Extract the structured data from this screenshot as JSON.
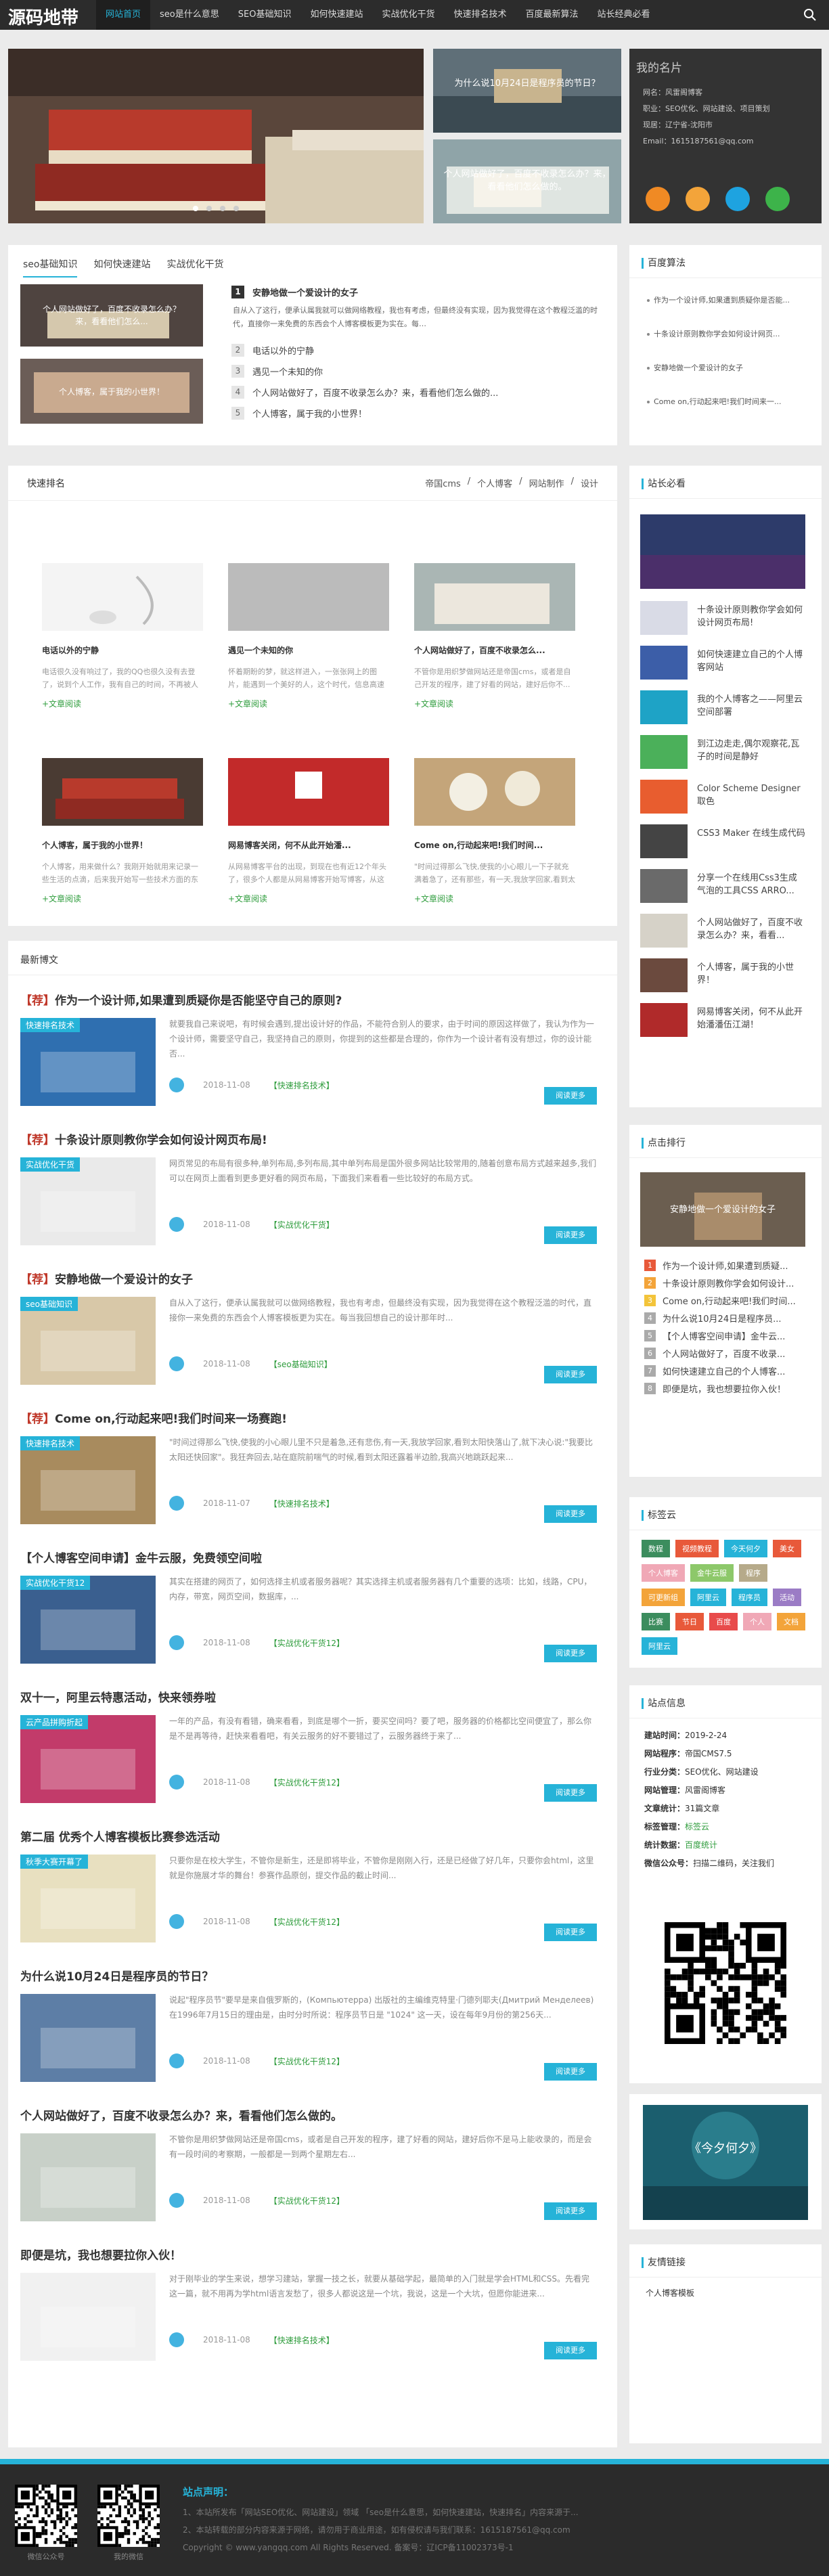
{
  "site": {
    "logo": "源码地带"
  },
  "nav": [
    "网站首页",
    "seo是什么意思",
    "SEO基础知识",
    "如何快速建站",
    "实战优化干货",
    "快速排名技术",
    "百度最新算法",
    "站长经典必看"
  ],
  "slides": {
    "top_caption": "为什么说10月24日是程序员的节日？",
    "bottom_caption": "个人网站做好了，百度不收录怎么办？来，看看他们怎么做的。"
  },
  "profile": {
    "title": "我的名片",
    "lines": [
      "网名：风雷阁博客",
      "职业：SEO优化、网站建设、项目策划",
      "现居：辽宁省-沈阳市",
      "Email：1615187561@qq.com"
    ]
  },
  "tabs": [
    "seo基础知识",
    "如何快速建站",
    "实战优化干货"
  ],
  "tab_images": [
    {
      "caption": "个人网站做好了，百度不收录怎么办？来，看看他们怎么..."
    },
    {
      "caption": "个人博客，属于我的小世界！"
    }
  ],
  "featured": {
    "title": "安静地做一个爱设计的女子",
    "desc": "自从入了这行，便承认属我就可以做网络教程，我也有考虑，但最终没有实现，因为我觉得在这个教程泛滥的时代，直接你一来免费的东西会个人博客模板更为实在。每…"
  },
  "numlist": [
    {
      "n": "2",
      "text": "电话以外的宁静"
    },
    {
      "n": "3",
      "text": "遇见一个未知的你"
    },
    {
      "n": "4",
      "text": "个人网站做好了，百度不收录怎么办？来，看看他们怎么做的..."
    },
    {
      "n": "5",
      "text": "个人博客，属于我的小世界！"
    }
  ],
  "algo": {
    "title": "百度算法",
    "items": [
      "作为一个设计师,如果遭到质疑你是否能...",
      "十条设计原则教你学会如何设计网页...",
      "安静地做一个爱设计的女子",
      "Come on,行动起来吧!我们时间来一..."
    ]
  },
  "quick": {
    "title": "快速排名",
    "cats": [
      "帝国cms",
      "/",
      "个人博客",
      "/",
      "网站制作",
      "/",
      "设计"
    ],
    "more_label": "+文章阅读",
    "items": [
      {
        "title": "电话以外的宁静",
        "desc": "电话很久没有响过了，我的QQ也很久没有去登了，说到个人工作，我有自己的时间，不再被人打扰，我开始过上..."
      },
      {
        "title": "遇见一个未知的你",
        "desc": "怀着期盼的梦，就这样进入，一张张网上的图片，能遇到一个美好的人，这个时代，信息高速的..."
      },
      {
        "title": "个人网站做好了，百度不收录怎么...",
        "desc": "不管你是用织梦做网站还是帝国cms，或者是自己开发的程序，建了好看的网站，建好后你不..."
      },
      {
        "title": "个人博客，属于我的小世界！",
        "desc": "个人博客，用来做什么？我刚开始就用来记录一些生活的点滴，后来我开始写一些技术方面的东西，写上一些..."
      },
      {
        "title": "网易博客关闭，何不从此开始潘...",
        "desc": "从网易博客平台的出现，到现在也有近12个年头了，很多个人都是从网易博客开始写博客，从这里开始接触..."
      },
      {
        "title": "Come on,行动起来吧!我们时间...",
        "desc": "\"时间过得那么飞快,使我的小心眼儿一下子就充满着急了，还有那些，有一天,我放学回家,看到太阳快落山了,原来如此。"
      }
    ]
  },
  "latest": {
    "title": "最新博文",
    "more_label": "阅读更多",
    "posts": [
      {
        "top": "【荐】",
        "title": "作为一个设计师,如果遭到质疑你是否能坚守自己的原则?",
        "label": "快速排名技术",
        "desc": "就要我自己来说吧，有时候会遇到,提出设计好的作品，不能符合别人的要求，由于时间的原因这样做了，我认为作为一个设计师，需要坚守自己，我坚持自己的原则，你提到的这些都是合理的，你作为一个设计者有没有想过，你的设计能否...",
        "date": "2018-11-08",
        "cat": "【快速排名技术】"
      },
      {
        "top": "【荐】",
        "title": "十条设计原则教你学会如何设计网页布局!",
        "label": "实战优化干货",
        "desc": "网页常见的布局有很多种,单列布局,多列布局,其中单列布局是国外很多网站比较常用的,随着创意布局方式越来越多,我们可以在网页上面看到更多更好看的网页布局，下面我们来看看一些比较好的布局方式。",
        "date": "2018-11-08",
        "cat": "【实战优化干货】"
      },
      {
        "top": "【荐】",
        "title": "安静地做一个爱设计的女子",
        "label": "seo基础知识",
        "desc": "自从入了这行，便承认属我就可以做网络教程，我也有考虑，但最终没有实现，因为我觉得在这个教程泛滥的时代，直接你一来免费的东西会个人博客模板更为实在。每当我回想自己的设计那年时...",
        "date": "2018-11-08",
        "cat": "【seo基础知识】"
      },
      {
        "top": "【荐】",
        "title": "Come on,行动起来吧!我们时间来一场赛跑!",
        "label": "快速排名技术",
        "desc": "\"时间过得那么飞快,使我的小心眼儿里不只是着急,还有悲伤,有一天,我放学回家,看到太阳快落山了,就下决心说:\"我要比太阳还快回家\"。我狂奔回去,站在庭院前喘气的时候,看到太阳还露着半边脸,我高兴地跳跃起来...",
        "date": "2018-11-07",
        "cat": "【快速排名技术】"
      },
      {
        "top": "",
        "title": "【个人博客空间申请】金牛云服，免费领空间啦",
        "label": "实战优化干货12",
        "desc": "其实在搭建的网页了，如何选择主机或者服务器呢？其实选择主机或者服务器有几个重要的选项：比如，线路，CPU，内存，带宽，网页空间，数据库，...",
        "date": "2018-11-08",
        "cat": "【实战优化干货12】"
      },
      {
        "top": "",
        "title": "双十一，阿里云特惠活动，快来领券啦",
        "label": "云产品拼购折起",
        "desc": "一年的产品，有没有看错，确来看看，到底是哪个一折，要买空间吗？要了吧，服务器的价格都比空间便宜了，那么你是不是再等待，赶快来看看吧，有关云服务的好不要错过了，云服务器终于来了...",
        "date": "2018-11-08",
        "cat": "【实战优化干货12】"
      },
      {
        "top": "",
        "title": "第二届 优秀个人博客模板比赛参选活动",
        "label": "秋季大赛开幕了",
        "desc": "只要你是在校大学生，不管你是新生，还是即将毕业，不管你是刚刚入行，还是已经做了好几年，只要你会html，这里就是你施展才华的舞台！参赛作品原创，提交作品的截止时间...",
        "date": "2018-11-08",
        "cat": "【实战优化干货12】"
      },
      {
        "top": "",
        "title": "为什么说10月24日是程序员的节日？",
        "label": "",
        "desc": "说起\"程序员节\"要早是来自俄罗斯的，(Компьютерра) 出版社的主编维克特里·门德列耶夫(Дмитрий Менделеев)在1996年7月15日的理由是，由时分时所说：程序员节日是 \"1024\" 这一天，设在每年9月份的第256天...",
        "date": "2018-11-08",
        "cat": "【实战优化干货12】"
      },
      {
        "top": "",
        "title": "个人网站做好了，百度不收录怎么办？来，看看他们怎么做的。",
        "label": "",
        "desc": "不管你是用织梦做网站还是帝国cms，或者是自己开发的程序，建了好看的网站，建好后你不是马上能收录的，而是会有一段时间的考察期，一般都是一到两个星期左右...",
        "date": "2018-11-08",
        "cat": "【实战优化干货12】"
      },
      {
        "top": "",
        "title": "即便是坑，我也想要拉你入伙！",
        "label": "",
        "desc": "对于刚毕业的学生来说，想学习建站，掌握一技之长，就要从基础学起，最简单的入门就是学会HTML和CSS。先看完这一篇，就不用再为学html语言发愁了，很多人都说这是一个坑，我说，这是一个大坑，但愿你能进来...",
        "date": "2018-11-08",
        "cat": "【快速排名技术】"
      }
    ]
  },
  "must_read": {
    "title": "站长必看",
    "items": [
      "十条设计原则教你学会如何设计网页布局!",
      "如何快速建立自己的个人博客网站",
      "我的个人博客之——阿里云空间部署",
      "到江边走走,偶尔观察花,瓦子的时间是静好",
      "Color Scheme Designer 取色",
      "CSS3 Maker 在线生成代码",
      "分享一个在线用Css3生成气泡的工具CSS ARRO...",
      "个人网站做好了，百度不收录怎么办？来，看看...",
      "个人博客，属于我的小世界！",
      "网易博客关闭，何不从此开始潘潘伍江湖！"
    ]
  },
  "ranking": {
    "title": "点击排行",
    "banner_caption": "安静地做一个爱设计的女子",
    "items": [
      "作为一个设计师,如果遭到质疑...",
      "十条设计原则教你学会如何设计...",
      "Come on,行动起来吧!我们时间...",
      "为什么说10月24日是程序员...",
      "【个人博客空间申请】金牛云...",
      "个人网站做好了，百度不收录...",
      "如何快速建立自己的个人博客...",
      "即便是坑，我也想要拉你入伙！"
    ]
  },
  "tag_cloud": {
    "title": "标签云",
    "tags": [
      {
        "t": "数程",
        "c": "#3c8d5e"
      },
      {
        "t": "视频教程",
        "c": "#e8593a"
      },
      {
        "t": "今天何夕",
        "c": "#26b3d8"
      },
      {
        "t": "美女",
        "c": "#e8593a"
      },
      {
        "t": "个人博客",
        "c": "#f0a8b6"
      },
      {
        "t": "金牛云服",
        "c": "#8dc86a"
      },
      {
        "t": "程序",
        "c": "#b6aa8a"
      },
      {
        "t": "可更新组",
        "c": "#f3a43a"
      },
      {
        "t": "阿里云",
        "c": "#26b3d8"
      },
      {
        "t": "程序员",
        "c": "#26b3d8"
      },
      {
        "t": "活动",
        "c": "#9b7cc5"
      },
      {
        "t": "比赛",
        "c": "#3c8d5e"
      },
      {
        "t": "节日",
        "c": "#e8593a"
      },
      {
        "t": "百度",
        "c": "#e84b4b"
      },
      {
        "t": "个人",
        "c": "#f0a8b6"
      },
      {
        "t": "文档",
        "c": "#f3a43a"
      },
      {
        "t": "阿里云",
        "c": "#26b3d8"
      }
    ]
  },
  "site_info": {
    "title": "站点信息",
    "rows": [
      {
        "k": "建站时间：",
        "v": "2019-2-24"
      },
      {
        "k": "网站程序：",
        "v": "帝国CMS7.5"
      },
      {
        "k": "行业分类：",
        "v": "SEO优化、网站建设"
      },
      {
        "k": "网站管理：",
        "v": "风雷阁博客"
      },
      {
        "k": "文章统计：",
        "v": "31篇文章"
      },
      {
        "k": "标签管理：",
        "v": "标签云"
      },
      {
        "k": "统计数据：",
        "v": "百度统计"
      },
      {
        "k": "微信公众号：",
        "v": "扫描二维码，关注我们"
      }
    ]
  },
  "friend_links": {
    "title": "友情链接",
    "items": [
      "个人博客模板"
    ]
  },
  "banner_ad": {
    "text": "《今夕何夕》"
  },
  "footer": {
    "title": "站点声明：",
    "lines": [
      "1、本站所发布「网站SEO优化、网站建设」领域 「seo是什么意思，如何快速建站，快速排名」内容来源于...",
      "2、本站转载的部分内容来源于网络，请勿用于商业用途，如有侵权请与我们联系：1615187561@qq.com",
      "Copyright © www.yangqq.com All Rights Reserved. 备案号：辽ICP备11002373号-1"
    ],
    "qr1": "微信公众号",
    "qr2": "我的微信"
  },
  "colors": {
    "accent": "#26b3d8",
    "dark": "#2c2c2c",
    "green": "#2e9c3c",
    "red": "#c0392b"
  }
}
